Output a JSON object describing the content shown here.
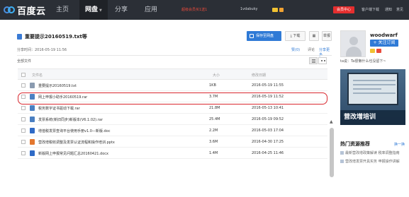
{
  "topbar": {
    "logo": "百度云",
    "nav": [
      {
        "label": "主页"
      },
      {
        "label": "网盘"
      },
      {
        "label": "分享"
      },
      {
        "label": "应用"
      }
    ],
    "promo": "超级会员买1送1",
    "username": "1vdabuky",
    "member_button": "会员中心",
    "links": [
      "客户端下载",
      "通知",
      "意见"
    ]
  },
  "file": {
    "title": "重要提示20160519.txt等",
    "share_time": "分享时间：2016-05-19 11:56",
    "save_button": "保存至网盘",
    "download_button": "下载",
    "report_button": "举报",
    "like": "赞(0)",
    "comment": "评论",
    "more_share": "分享更多"
  },
  "list": {
    "all_files": "全部文件",
    "columns": {
      "name": "文件名",
      "size": "大小",
      "date": "修改日期"
    },
    "rows": [
      {
        "name": "重要提示20160519.txt",
        "size": "1KB",
        "date": "2016-05-19 11:55",
        "type": "txt"
      },
      {
        "name": "网上申报小助手20160519.rar",
        "size": "3.7M",
        "date": "2016-05-19 11:52",
        "type": "rar"
      },
      {
        "name": "税务数字证书驱动下载.rar",
        "size": "21.8M",
        "date": "2016-05-13 10:41",
        "type": "rar"
      },
      {
        "name": "发票系统(新旧同步)新版本(V6.1.02).rar",
        "size": "25.4M",
        "date": "2016-05-19 09:52",
        "type": "rar"
      },
      {
        "name": "增值税发票查询平台使用手册v1.0—新版.doc",
        "size": "2.2M",
        "date": "2016-05-03 17:04",
        "type": "doc"
      },
      {
        "name": "营改增税收调整及发票认证流程和操作培训.pptx",
        "size": "3.6M",
        "date": "2016-04-30 17:25",
        "type": "ppt"
      },
      {
        "name": "新版网上申报常见问题汇总20160421.docx",
        "size": "1.4M",
        "date": "2016-04-25 11:46",
        "type": "docx"
      }
    ]
  },
  "sidebar": {
    "username": "woodwarf",
    "follow_button": "+ 关注订阅",
    "description": "ta说：Ta很懒什么也没留下~",
    "ad_label": "营改增培训",
    "hot_title": "热门资源推荐",
    "change_label": "换一换",
    "hot_items": [
      "最新营改增政策解读 税率调整指南",
      "营改增发票开具实务 申报操作讲解"
    ]
  }
}
